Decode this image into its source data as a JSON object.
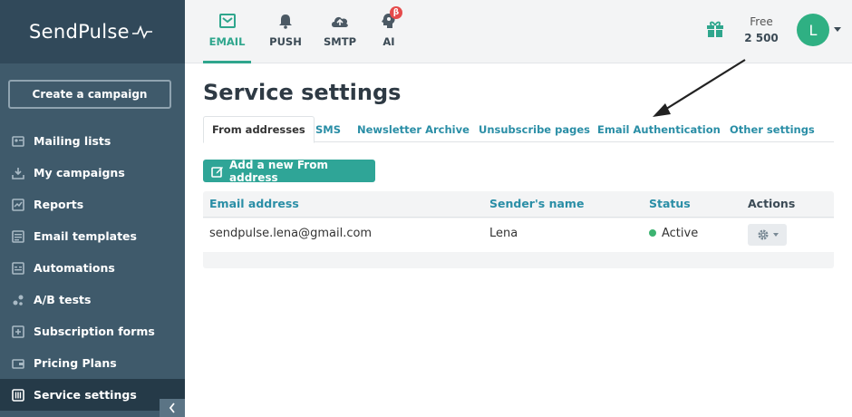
{
  "brand": {
    "name": "SendPulse"
  },
  "sidebar": {
    "create_label": "Create a campaign",
    "items": [
      {
        "label": "Mailing lists",
        "icon": "mailing-lists-icon"
      },
      {
        "label": "My campaigns",
        "icon": "campaigns-icon"
      },
      {
        "label": "Reports",
        "icon": "reports-icon"
      },
      {
        "label": "Email templates",
        "icon": "templates-icon"
      },
      {
        "label": "Automations",
        "icon": "automations-icon"
      },
      {
        "label": "A/B tests",
        "icon": "ab-tests-icon"
      },
      {
        "label": "Subscription forms",
        "icon": "forms-icon"
      },
      {
        "label": "Pricing Plans",
        "icon": "wallet-icon"
      },
      {
        "label": "Service settings",
        "icon": "settings-sliders-icon",
        "active": true
      }
    ]
  },
  "topbar": {
    "tabs": [
      {
        "label": "EMAIL",
        "icon": "email-icon",
        "active": true
      },
      {
        "label": "PUSH",
        "icon": "bell-icon"
      },
      {
        "label": "SMTP",
        "icon": "cloud-icon"
      },
      {
        "label": "AI",
        "icon": "ai-head-icon",
        "badge": "β"
      }
    ],
    "plan_name": "Free",
    "plan_amount": "2 500",
    "avatar_initial": "L"
  },
  "page": {
    "title": "Service settings",
    "tabs": [
      "From addresses",
      "SMS",
      "Newsletter Archive",
      "Unsubscribe pages",
      "Email Authentication",
      "Other settings"
    ],
    "active_tab": "From addresses",
    "add_button": "Add a new From address"
  },
  "table": {
    "headers": [
      "Email address",
      "Sender's name",
      "Status",
      "Actions"
    ],
    "rows": [
      {
        "email": "sendpulse.lena@gmail.com",
        "sender": "Lena",
        "status": "Active"
      }
    ]
  },
  "colors": {
    "accent": "#2fa68d",
    "sidebar": "#3f5a6b",
    "link": "#2a8ea6",
    "status_active": "#3cb371"
  }
}
